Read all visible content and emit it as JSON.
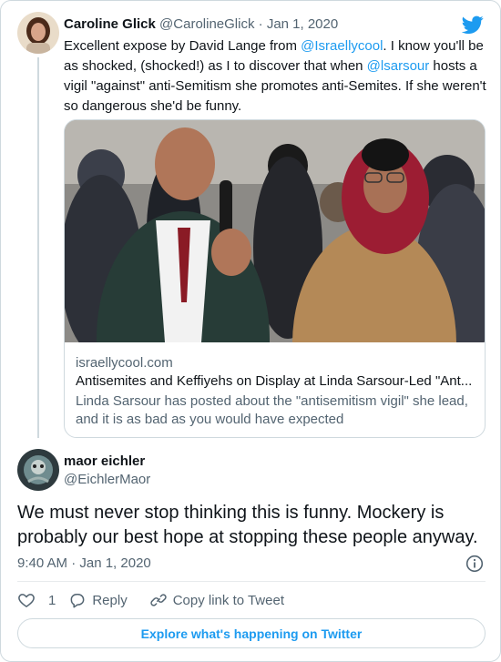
{
  "parent_tweet": {
    "author_name": "Caroline Glick",
    "author_handle": "@CarolineGlick",
    "separator": "·",
    "date": "Jan 1, 2020",
    "text_1": "Excellent expose by David Lange from ",
    "mention_1": "@Israellycool",
    "text_2": ". I know you'll be as shocked, (shocked!) as I to discover that when ",
    "mention_2": "@lsarsour",
    "text_3": " hosts a vigil \"against\" anti-Semitism she promotes anti-Semites. If she weren't so dangerous she'd be funny.",
    "link_card": {
      "domain": "israellycool.com",
      "title": "Antisemites and Keffiyehs on Display at Linda Sarsour-Led \"Ant...",
      "description": "Linda Sarsour has posted about the \"antisemitism vigil\" she lead, and it is as bad as you would have expected"
    }
  },
  "reply_tweet": {
    "author_name": "maor eichler",
    "author_handle": "@EichlerMaor",
    "text": "We must never stop thinking this is funny. Mockery is probably our best hope at stopping these people anyway.",
    "timestamp": "9:40 AM · Jan 1, 2020",
    "like_count": "1",
    "reply_label": "Reply",
    "copy_link_label": "Copy link to Tweet"
  },
  "explore_button": "Explore what's happening on Twitter",
  "colors": {
    "accent": "#1d9bf0",
    "secondary_text": "#536471",
    "border": "#cfd9de"
  },
  "icons": [
    "twitter-bird-icon",
    "info-icon",
    "heart-icon",
    "reply-bubble-icon",
    "link-icon"
  ]
}
